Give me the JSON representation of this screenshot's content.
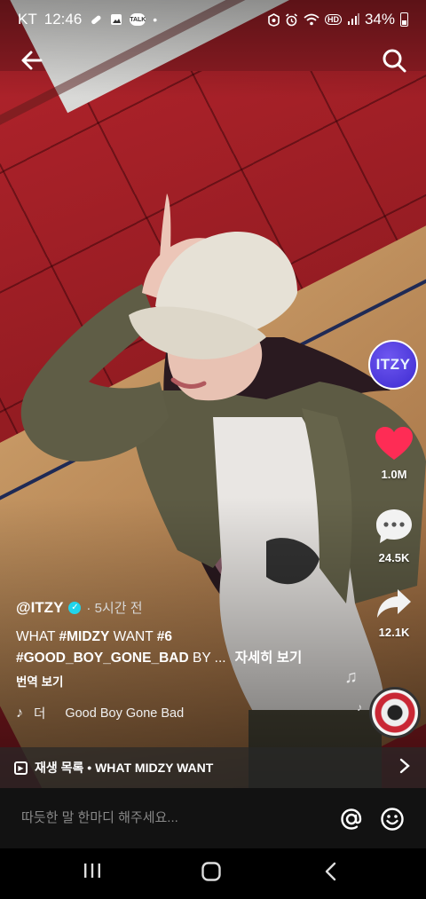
{
  "status_bar": {
    "carrier": "KT",
    "time": "12:46",
    "battery": "34%",
    "talk_badge": "TALK",
    "hd_badge": "HD"
  },
  "nav": {
    "back_icon": "arrow-left-icon",
    "search_icon": "search-icon"
  },
  "rail": {
    "avatar_text": "ITZY",
    "likes": "1.0M",
    "comments": "24.5K",
    "shares": "12.1K"
  },
  "caption": {
    "author": "@ITZY",
    "time_ago": "· 5시간 전",
    "line1_pre": "WHAT ",
    "line1_tag1": "#MIDZY",
    "line1_mid": " WANT ",
    "line1_tag2": "#6",
    "line2_tag": "#GOOD_BOY_GONE_BAD",
    "line2_post": " BY ...",
    "see_more": "자세히 보기",
    "translate": "번역 보기"
  },
  "sound": {
    "prefix": "더",
    "title": "Good Boy Gone Bad"
  },
  "playlist": {
    "label": "재생 목록 • WHAT MIDZY WANT"
  },
  "comment": {
    "placeholder": "따듯한 말 한마디 해주세요..."
  },
  "colors": {
    "heart": "#fe2c55",
    "avatar": "#4b37e0",
    "verified": "#20d5ec"
  }
}
